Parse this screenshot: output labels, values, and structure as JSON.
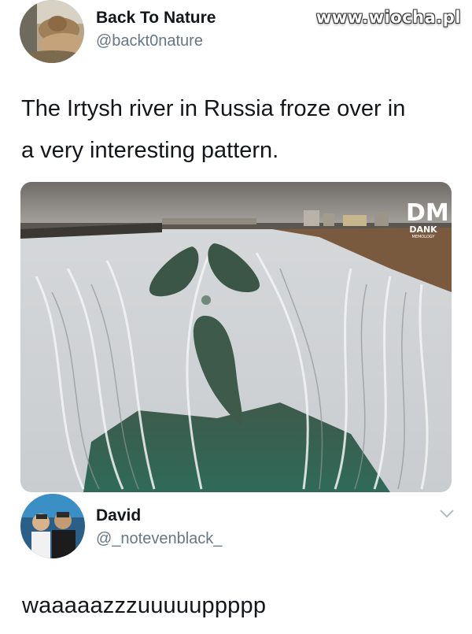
{
  "watermark": "www.wiocha.pl",
  "tweet": {
    "author_name": "Back To Nature",
    "author_handle": "@backt0nature",
    "text_line1": "The Irtysh river in Russia froze over in",
    "text_line2": "a very interesting pattern.",
    "avatar_icon": "profile-photo",
    "photo": {
      "logo_big": "DM",
      "logo_small": "DANK",
      "logo_tiny": "MEMOLOGY"
    }
  },
  "reply": {
    "author_name": "David",
    "author_handle": "@_notevenblack_",
    "text": "waaaaazzzuuuuuppppp",
    "avatar_icon": "profile-photo",
    "menu_icon": "chevron-down-icon"
  }
}
